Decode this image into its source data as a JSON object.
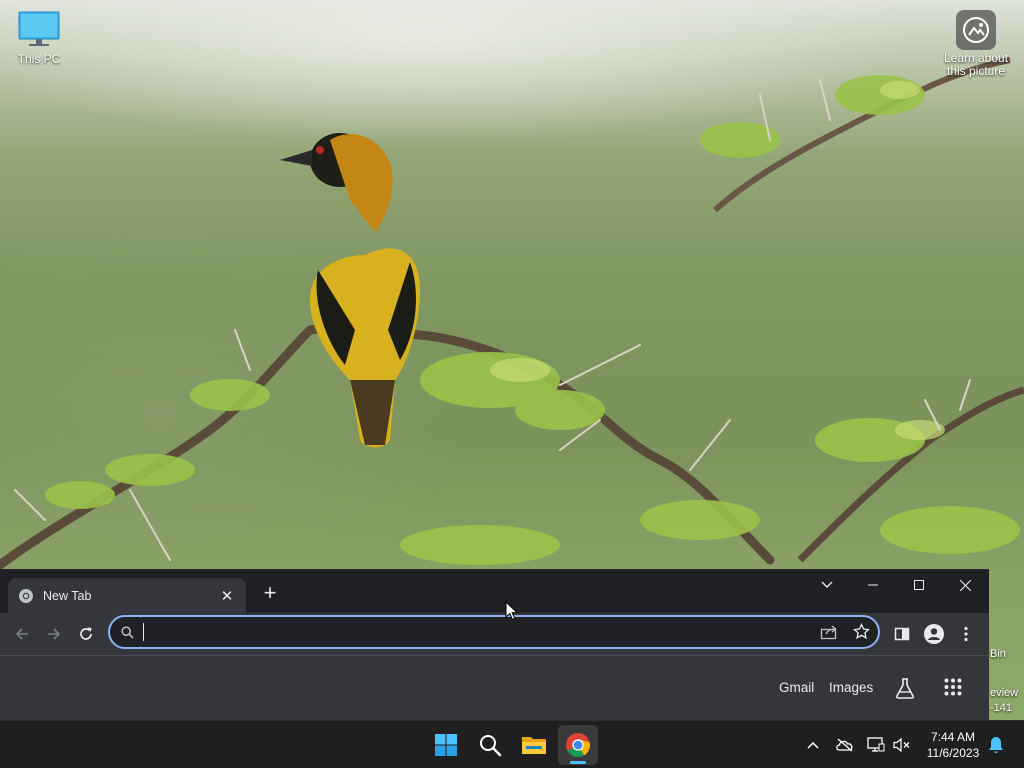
{
  "desktop": {
    "icons": [
      {
        "label": "This PC"
      },
      {
        "label": "Learn about this picture"
      }
    ],
    "edge_fragments": [
      "Bin",
      "eview",
      "-141"
    ]
  },
  "browser": {
    "tab": {
      "title": "New Tab"
    },
    "omnibox": {
      "value": "",
      "placeholder": ""
    },
    "ntp_links": {
      "gmail": "Gmail",
      "images": "Images"
    }
  },
  "taskbar": {
    "apps": [
      "start-icon",
      "search-icon",
      "file-explorer-icon",
      "chrome-icon"
    ],
    "clock": {
      "time": "7:44 AM",
      "date": "11/6/2023"
    }
  },
  "colors": {
    "omnibox_focus": "#8ab4f8",
    "taskbar_active_indicator": "#4cc2ff",
    "notification_bell": "#4cc2ff"
  }
}
